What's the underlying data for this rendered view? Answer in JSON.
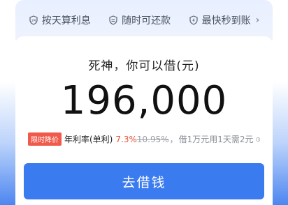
{
  "features": [
    {
      "icon": "calendar-icon",
      "label": "按天算利息"
    },
    {
      "icon": "repay-icon",
      "label": "随时可还款"
    },
    {
      "icon": "lightning-icon",
      "label": "最快秒到账"
    }
  ],
  "features_more_icon": "chevron-right-icon",
  "loan": {
    "headline": "死神，你可以借(元)",
    "amount": "196,000"
  },
  "rate": {
    "badge": "限时降价",
    "label": "年利率(单利)",
    "current": "7.3%",
    "original": "10.95%",
    "separator": "，",
    "note": "借1万元用1天需2元"
  },
  "cta": {
    "label": "去借钱"
  },
  "colors": {
    "accent": "#3b7bf0",
    "badge": "#ef5a4b",
    "rate": "#e8533e"
  }
}
